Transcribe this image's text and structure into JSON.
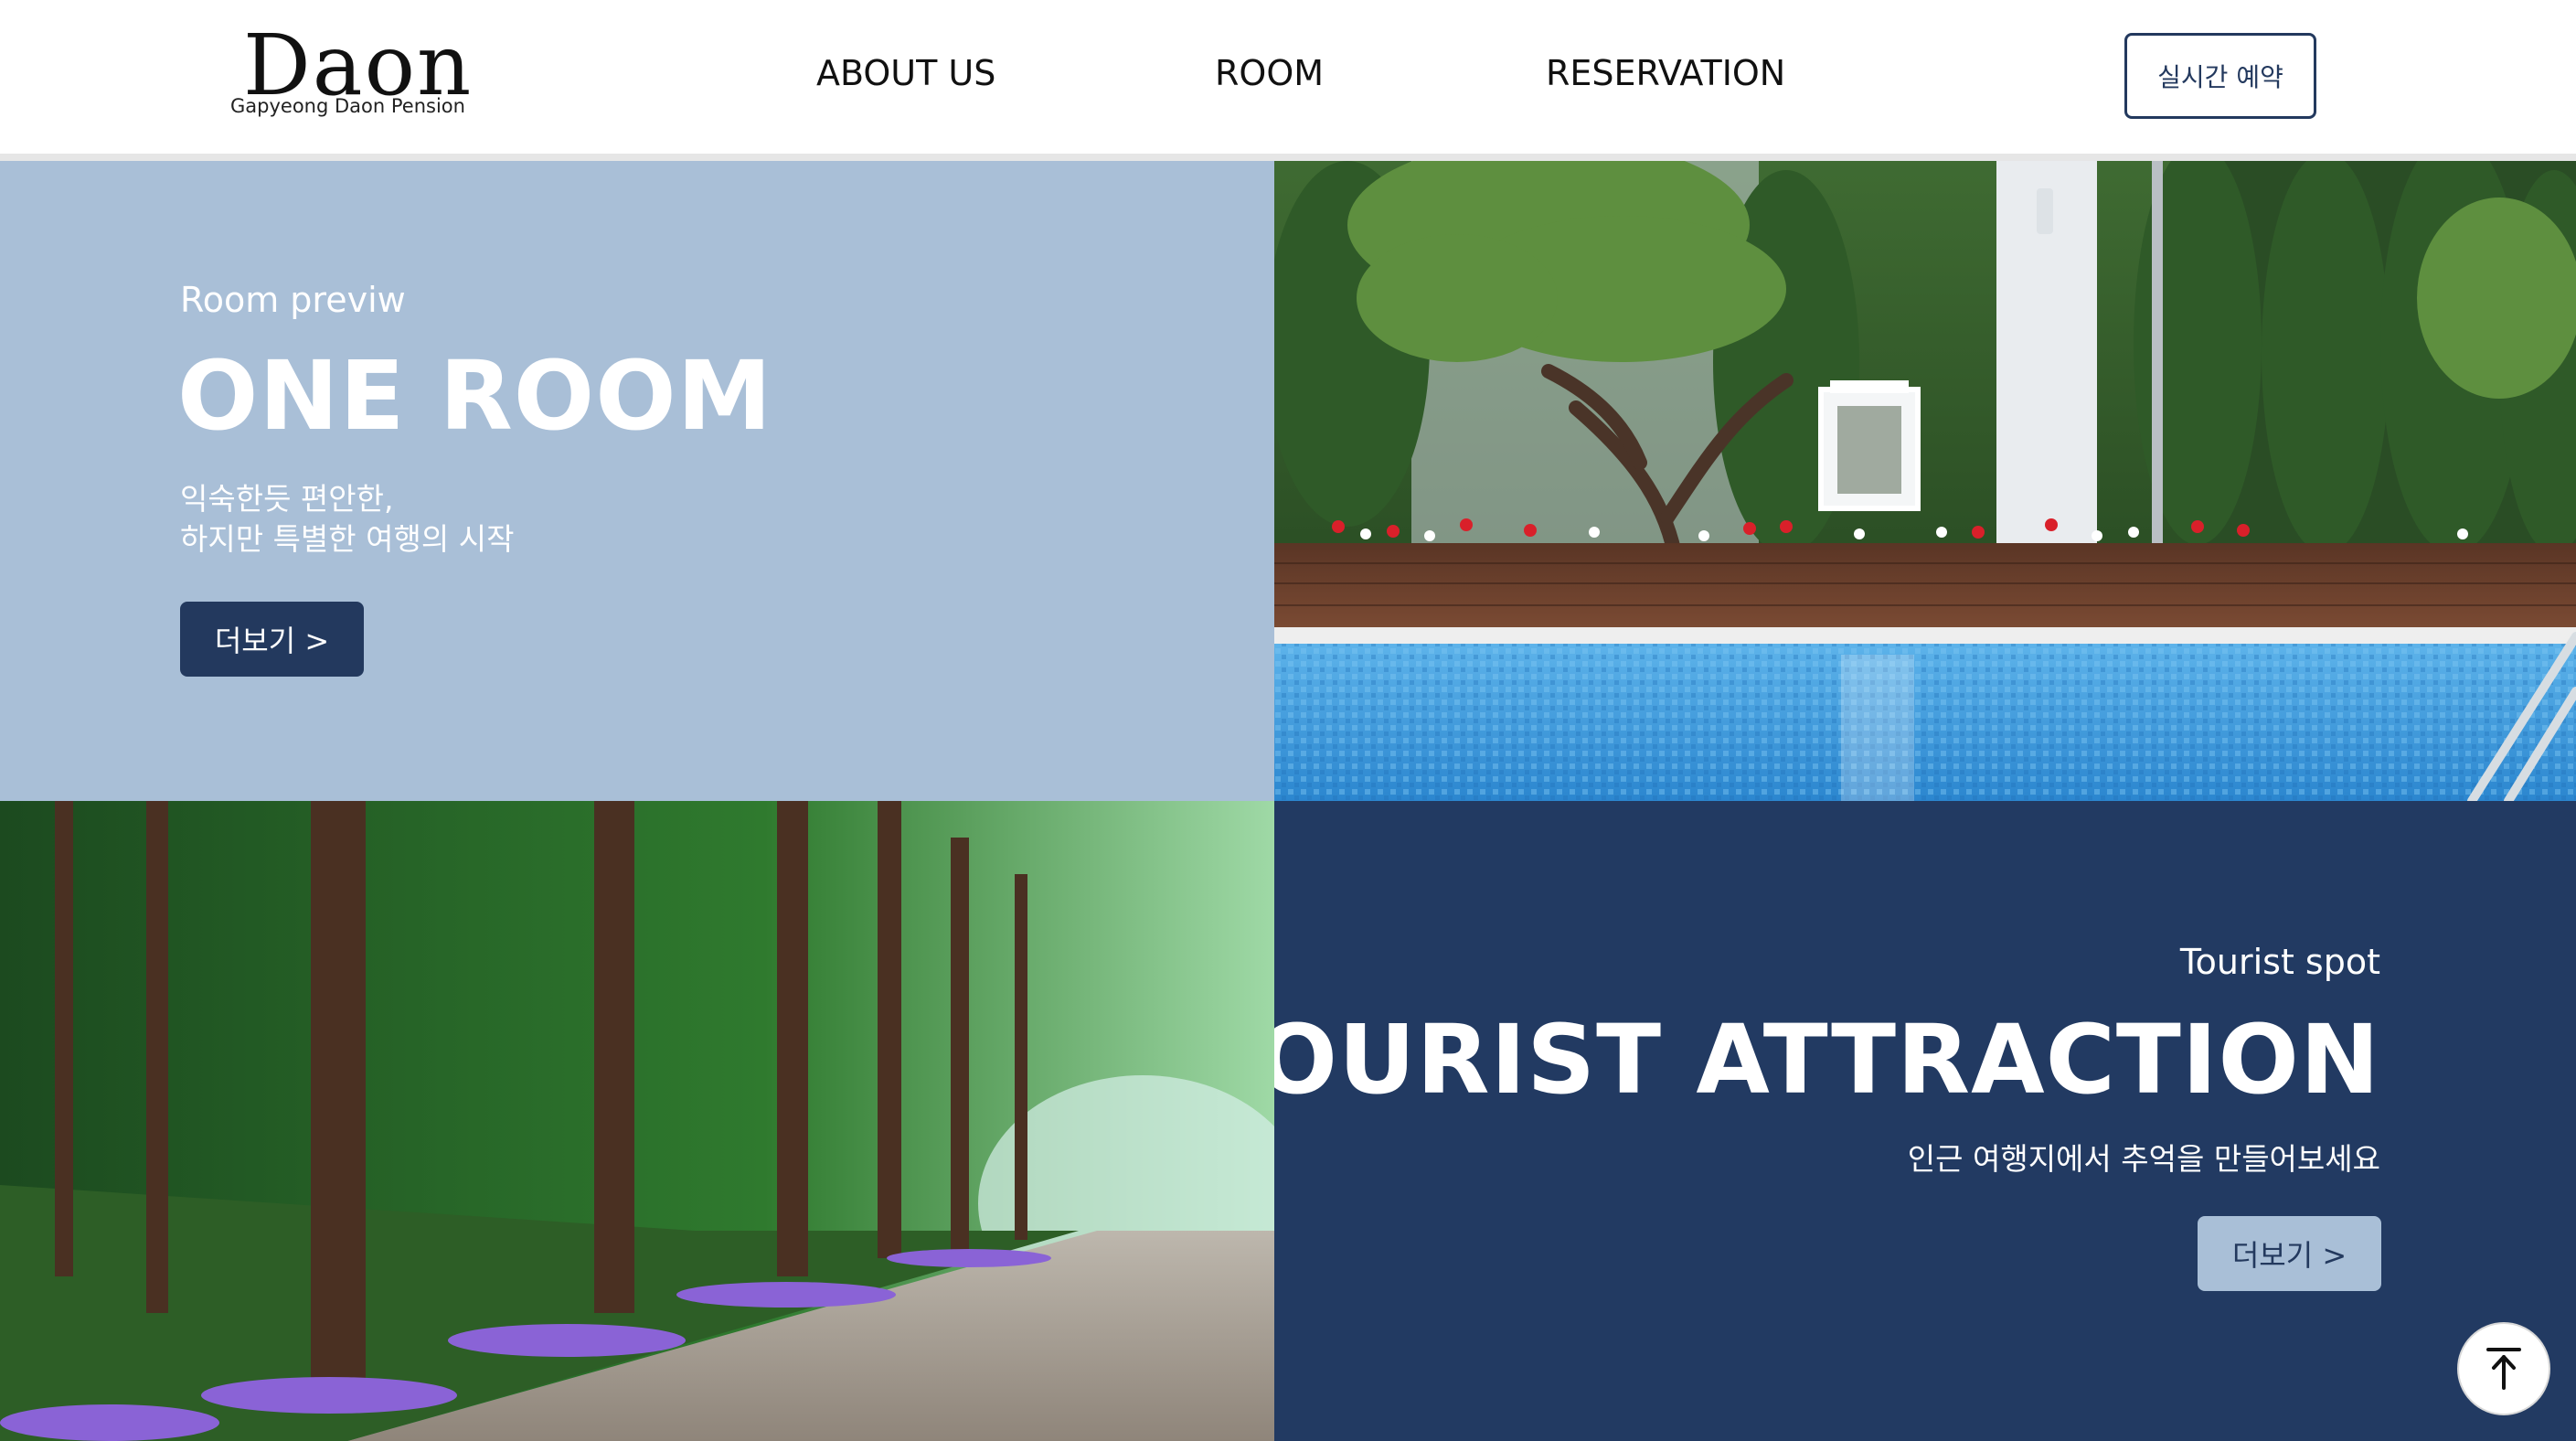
{
  "header": {
    "logo_word": "Daon",
    "logo_sub": "Gapyeong Daon Pension",
    "nav": [
      "ABOUT US",
      "ROOM",
      "RESERVATION"
    ],
    "reserve_label": "실시간 예약"
  },
  "room_section": {
    "kicker": "Room previw",
    "title": "ONE ROOM",
    "desc_lines": [
      "익숙한듯 편안한,",
      "하지만 특별한 여행의 시작"
    ],
    "button_label": "더보기 >",
    "image": "pool-garden-photo"
  },
  "tour_section": {
    "kicker": "Tourist spot",
    "title": "TOURIST ATTRACTION",
    "desc": "인근 여행지에서 추억을 만들어보세요",
    "button_label": "더보기 >",
    "image": "forest-path-photo"
  },
  "scroll_top": {
    "icon": "arrow-up-to-top-icon"
  },
  "colors": {
    "navy": "#223a62",
    "light_blue": "#a9bfd7",
    "white": "#ffffff"
  }
}
